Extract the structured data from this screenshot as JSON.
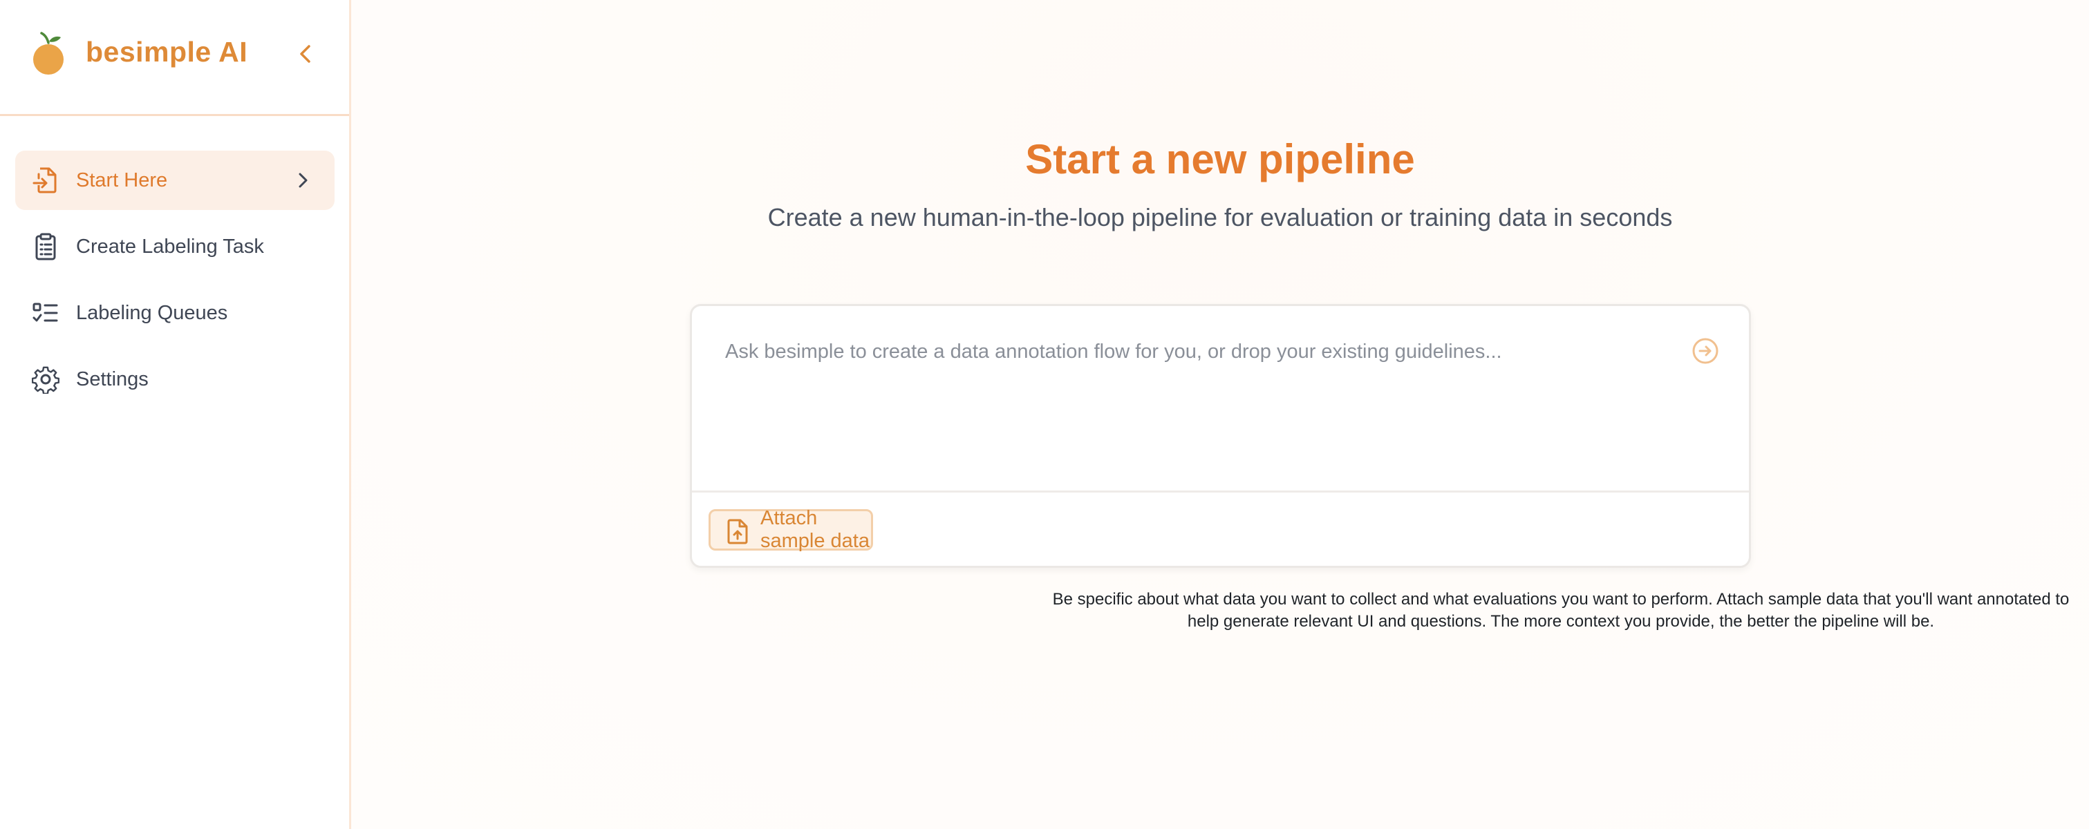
{
  "app": {
    "brand_name": "besimple AI",
    "accent_color": "#de8a37"
  },
  "sidebar": {
    "collapse_icon": "chevron-left-icon",
    "items": [
      {
        "label": "Start Here",
        "icon": "file-import-icon",
        "active": true
      },
      {
        "label": "Create Labeling Task",
        "icon": "clipboard-list-icon",
        "active": false
      },
      {
        "label": "Labeling Queues",
        "icon": "list-checks-icon",
        "active": false
      },
      {
        "label": "Settings",
        "icon": "gear-icon",
        "active": false
      }
    ]
  },
  "main": {
    "title": "Start a new pipeline",
    "subtitle": "Create a new human-in-the-loop pipeline for evaluation or training data in seconds",
    "prompt": {
      "placeholder": "Ask besimple to create a data annotation flow for you, or drop your existing guidelines...",
      "value": ""
    },
    "attach_label": "Attach sample data",
    "hint": "Be specific about what data you want to collect and what evaluations you want to perform. Attach sample data that you'll want annotated to help generate relevant UI and questions. The more context you provide, the better the pipeline will be."
  }
}
